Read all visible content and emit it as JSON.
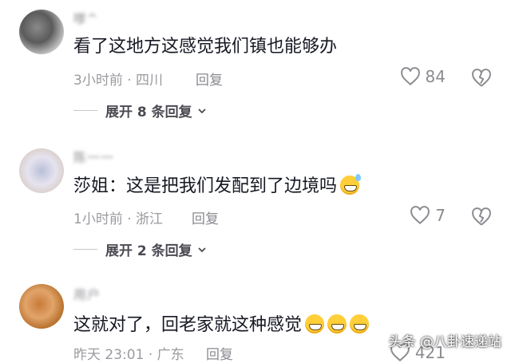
{
  "comments": [
    {
      "username": "嗲^",
      "text": "看了这地方这感觉我们镇也能够办",
      "time": "3小时前",
      "location": "四川",
      "reply_label": "回复",
      "likes": "84",
      "expand_label": "展开 8 条回复"
    },
    {
      "username": "陈一一",
      "text": "莎姐：这是把我们发配到了边境吗",
      "emoji": "sweat-grin-emoji",
      "time": "1小时前",
      "location": "浙江",
      "reply_label": "回复",
      "likes": "7",
      "expand_label": "展开 2 条回复"
    },
    {
      "username": "用户 ",
      "text": "这就对了，回老家就这种感觉",
      "emoji": "grin-emoji",
      "time": "昨天 23:01",
      "location": "广东",
      "reply_label": "回复",
      "likes": "421"
    }
  ],
  "watermark": "头条 @八卦速递站",
  "colors": {
    "text": "#161823",
    "meta": "#9a9aa0",
    "emoji": "#ffcf3a"
  }
}
